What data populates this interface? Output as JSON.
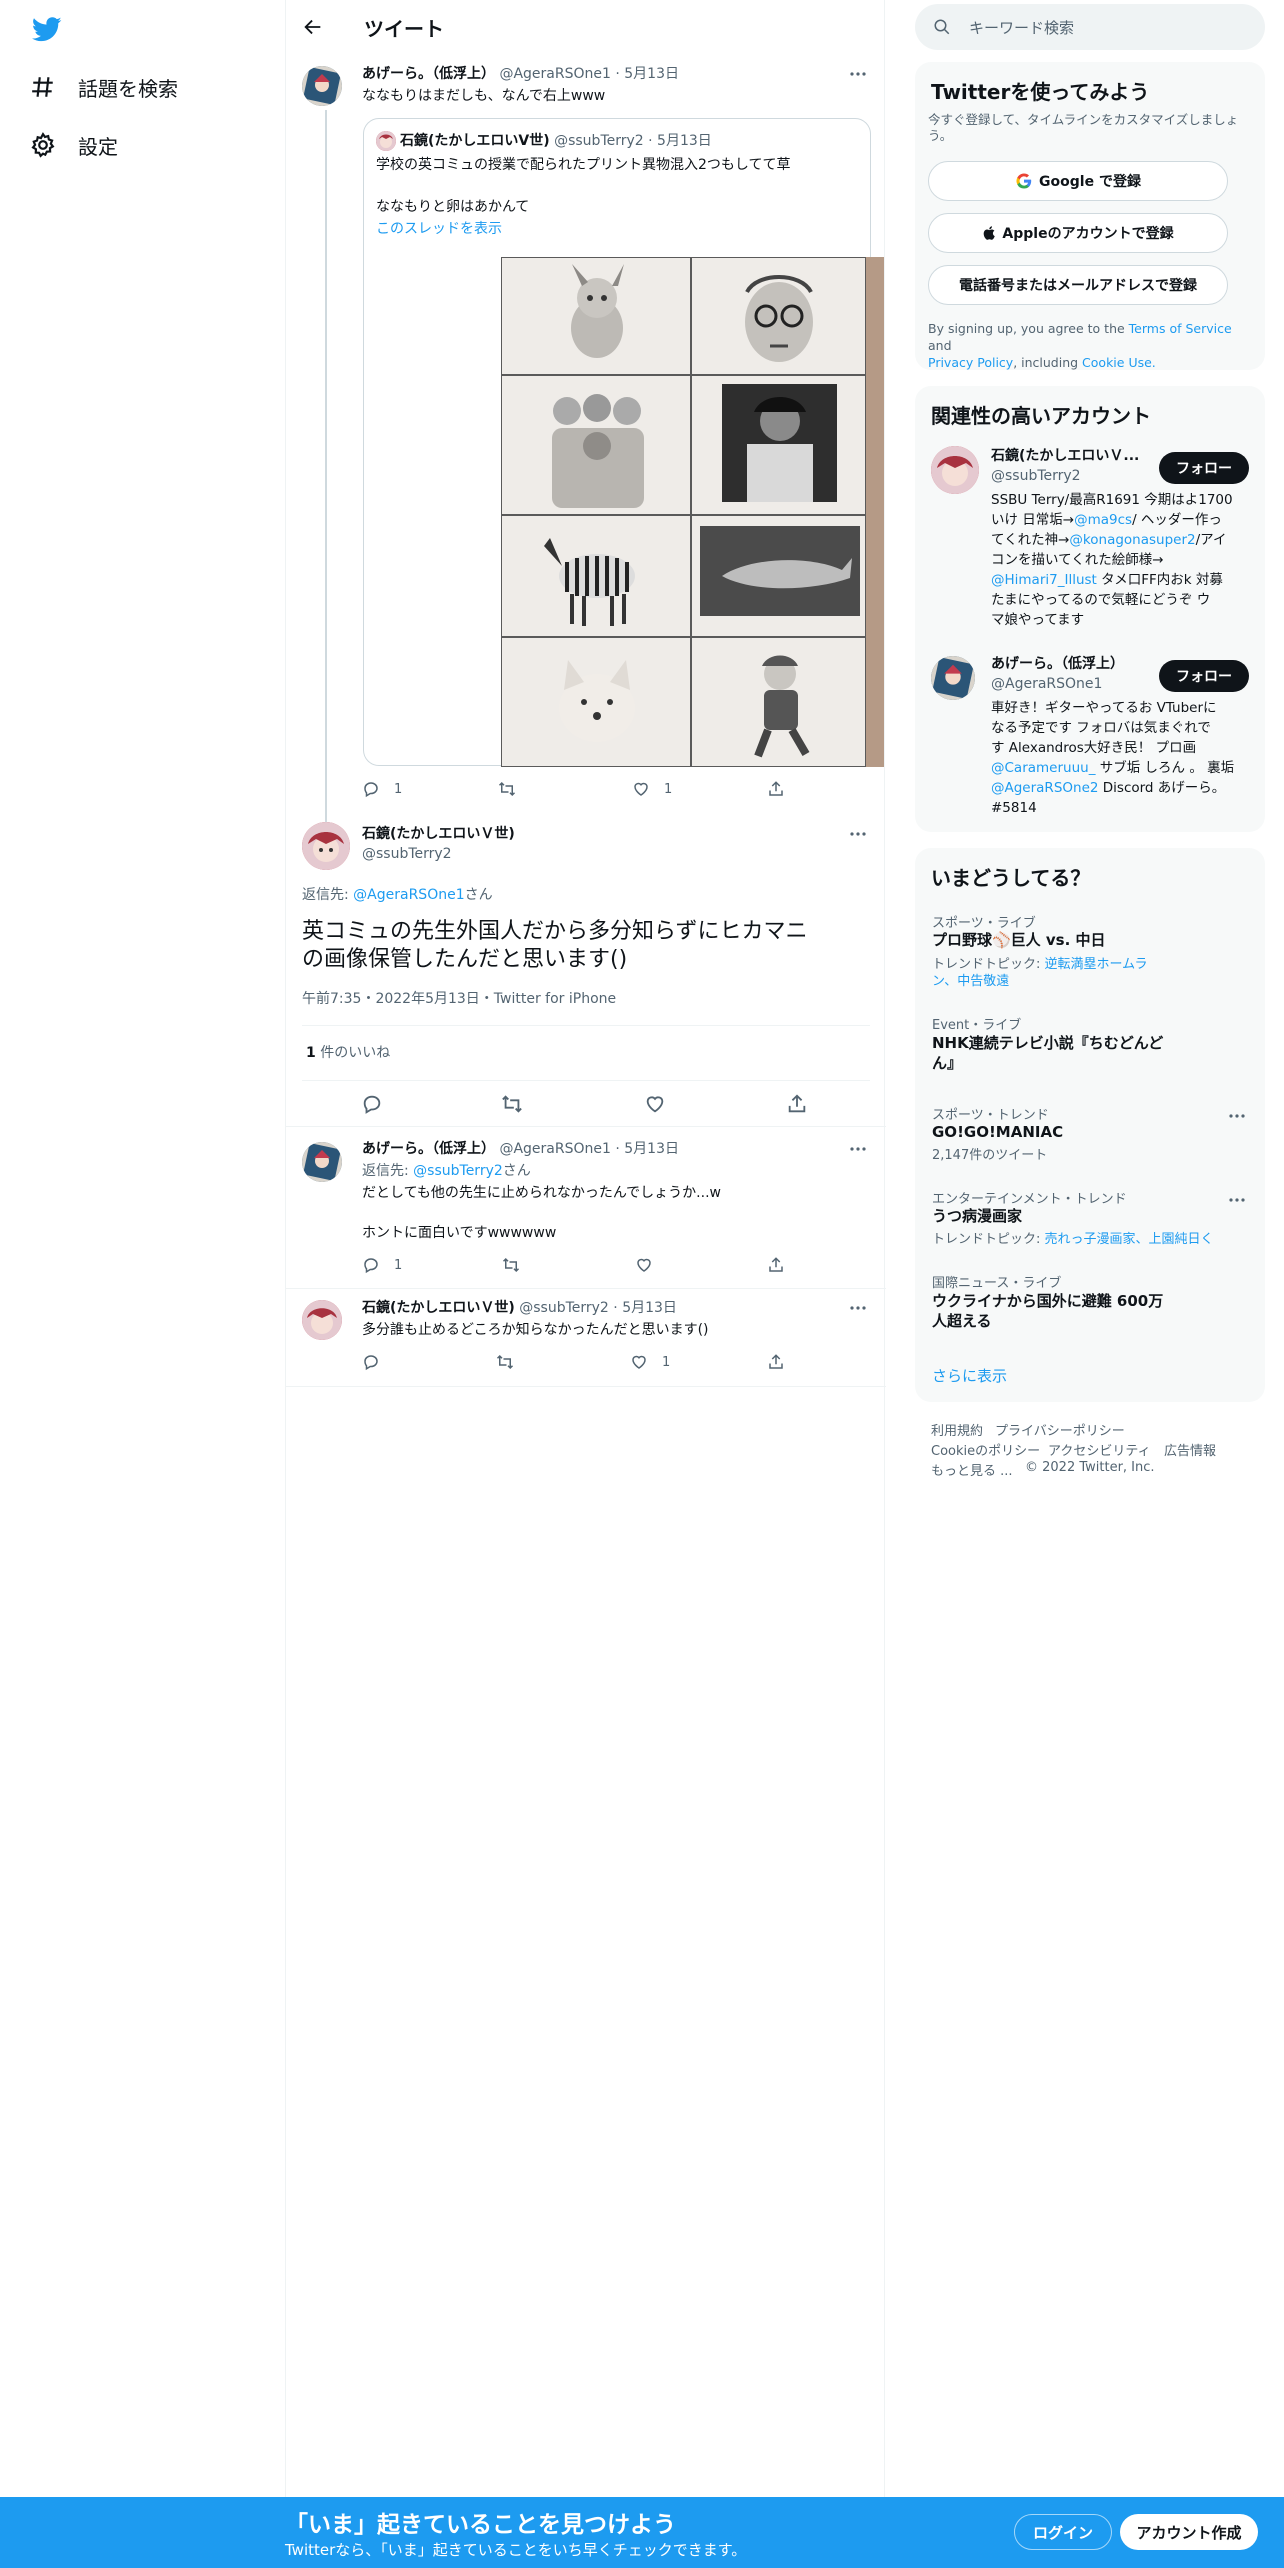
{
  "nav": {
    "explore_label": "話題を検索",
    "settings_label": "設定"
  },
  "header": {
    "title": "ツイート"
  },
  "tweet1": {
    "name": "あげーら。（低浮上）",
    "handle": "@AgeraRSOne1",
    "date": "5月13日",
    "text": "ななもりはまだしも、なんで右上www",
    "reply_count": "1",
    "like_count": "1"
  },
  "quoted": {
    "name": "石鏡(たかしエロいV世)",
    "handle": "@ssubTerry2",
    "date": "5月13日",
    "line1": "学校の英コミュの授業で配られたプリント異物混入2つもしてて草",
    "line2": "ななもりと卵はあかんて",
    "thread_link": "このスレッドを表示"
  },
  "main_tweet": {
    "name": "石鏡(たかしエロいＶ世)",
    "handle": "@ssubTerry2",
    "reply_prefix": "返信先:",
    "reply_to": "@AgeraRSOne1",
    "reply_suffix": "さん",
    "line1": "英コミュの先生外国人だから多分知らずにヒカマニ",
    "line2": "の画像保管したんだと思います()",
    "meta": "午前7:35・2022年5月13日・Twitter for iPhone",
    "likes_num": "1",
    "likes_label": "件のいいね"
  },
  "reply1": {
    "name": "あげーら。（低浮上）",
    "handle": "@AgeraRSOne1",
    "date": "5月13日",
    "reply_prefix": "返信先:",
    "reply_to": "@ssubTerry2",
    "reply_suffix": "さん",
    "line1": "だとしても他の先生に止められなかったんでしょうか...w",
    "line2": "ホントに面白いですwwwwww",
    "reply_count": "1"
  },
  "reply2": {
    "name": "石鏡(たかしエロいＶ世)",
    "handle": "@ssubTerry2",
    "date": "5月13日",
    "text": "多分誰も止めるどころか知らなかったんだと思います()",
    "like_count": "1"
  },
  "search": {
    "placeholder": "キーワード検索"
  },
  "signup_panel": {
    "title": "Twitterを使ってみよう",
    "subtitle_line1": "今すぐ登録して、タイムラインをカスタマイズしましょ",
    "subtitle_line2": "う。",
    "google": "Google で登録",
    "apple": "Appleのアカウントで登録",
    "phone": "電話番号またはメールアドレスで登録",
    "legal_1": "By signing up, you agree to the ",
    "legal_terms": "Terms of Service",
    "legal_2": " and",
    "legal_privacy": "Privacy Policy",
    "legal_3": ", including ",
    "legal_cookie": "Cookie Use."
  },
  "related": {
    "title": "関連性の高いアカウント",
    "follow_label": "フォロー",
    "acct1": {
      "name": "石鏡(たかしエロいＶ...",
      "handle": "@ssubTerry2",
      "bio1": "SSBU Terry/最高R1691 今期はよ1700",
      "bio2a": "いけ 日常垢→",
      "bio2b": "@ma9cs",
      "bio2c": "/ ヘッダー作っ",
      "bio3a": "てくれた神→",
      "bio3b": "@konagonasuper2",
      "bio3c": "/アイ",
      "bio4": "コンを描いてくれた絵師様→",
      "bio5a": "@Himari7_Illust",
      "bio5b": " タメ口FF内おk 対募",
      "bio6": "たまにやってるので気軽にどうぞ ウ",
      "bio7": "マ娘やってます"
    },
    "acct2": {
      "name": "あげーら。（低浮上）",
      "handle": "@AgeraRSOne1",
      "bio1": "車好き！ギターやってるお VTuberに",
      "bio2": "なる予定です フォロバは気まぐれで",
      "bio3": "す Alexandros大好き民！ プロ画",
      "bio4a": "@Carameruuu_",
      "bio4b": " サブ垢 しろん 。 裏垢",
      "bio5a": "@AgeraRSOne2",
      "bio5b": " Discord あげーら。",
      "bio6": "#5814"
    }
  },
  "trends": {
    "title": "いまどうしてる？",
    "items": [
      {
        "cat": "スポーツ・ライブ",
        "name": "プロ野球⚾巨人 vs. 中日",
        "sub_prefix": "トレンドトピック: ",
        "sub_link1": "逆転満塁ホームラ",
        "sub_link2": "ン、中告敬遠"
      },
      {
        "cat": "Event・ライブ",
        "name1": "NHK連続テレビ小説『ちむどんど",
        "name2": "ん』"
      },
      {
        "cat": "スポーツ・トレンド",
        "name": "GO!GO!MANIAC",
        "sub": "2,147件のツイート"
      },
      {
        "cat": "エンターテインメント・トレンド",
        "name": "うつ病漫画家",
        "sub_prefix": "トレンドトピック: ",
        "sub_link1": "売れっ子漫画家、上園純日く"
      },
      {
        "cat": "国際ニュース・ライブ",
        "name1": "ウクライナから国外に避難 600万",
        "name2": "人超える"
      }
    ],
    "show_more": "さらに表示"
  },
  "footer": {
    "terms": "利用規約",
    "privacy": "プライバシーポリシー",
    "cookie": "Cookieのポリシー",
    "accessibility": "アクセシビリティ",
    "ads": "広告情報",
    "more": "もっと見る ...",
    "copyright": "© 2022 Twitter, Inc."
  },
  "bottom_bar": {
    "headline": "「いま」起きていることを見つけよう",
    "sub": "Twitterなら、「いま」起きていることをいち早くチェックできます。",
    "login": "ログイン",
    "signup": "アカウント作成"
  },
  "colors": {
    "accent": "#1d9bf0",
    "text": "#0f1419",
    "secondary": "#536471",
    "panel_bg": "#f7f9f9",
    "border": "#eff3f4"
  }
}
